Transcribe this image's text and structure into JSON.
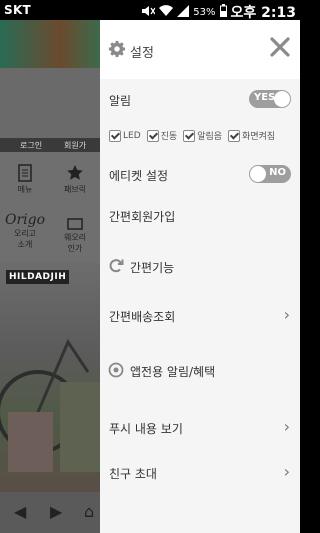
{
  "status": {
    "carrier": "SKT",
    "battery": "53%",
    "time": "오후 2:13"
  },
  "background": {
    "login": "로그인",
    "signup": "회원가",
    "menu": "메뉴",
    "favorite": "패브릭",
    "brand": "Origo",
    "brand_sub1": "오리고",
    "brand_sub2": "소개",
    "shop_sub1": "웨오리",
    "shop_sub2": "인가",
    "tag": "HILDADJIH"
  },
  "drawer": {
    "title": "설정",
    "items": {
      "alarm": "알림",
      "alarm_toggle": "YES",
      "etiquette": "에티켓 설정",
      "etiquette_toggle": "NO",
      "easy_signup": "간편회원가입",
      "easy_function": "간편기능",
      "easy_delivery": "간편배송조회",
      "app_alarm": "앱전용 알림/혜택",
      "push_view": "푸시 내용 보기",
      "invite": "친구 초대"
    },
    "checks": [
      "LED",
      "진동",
      "알림음",
      "화면켜짐"
    ]
  },
  "colors": {
    "toggle_on": "#9e9e9e",
    "toggle_off": "#9e9e9e"
  }
}
